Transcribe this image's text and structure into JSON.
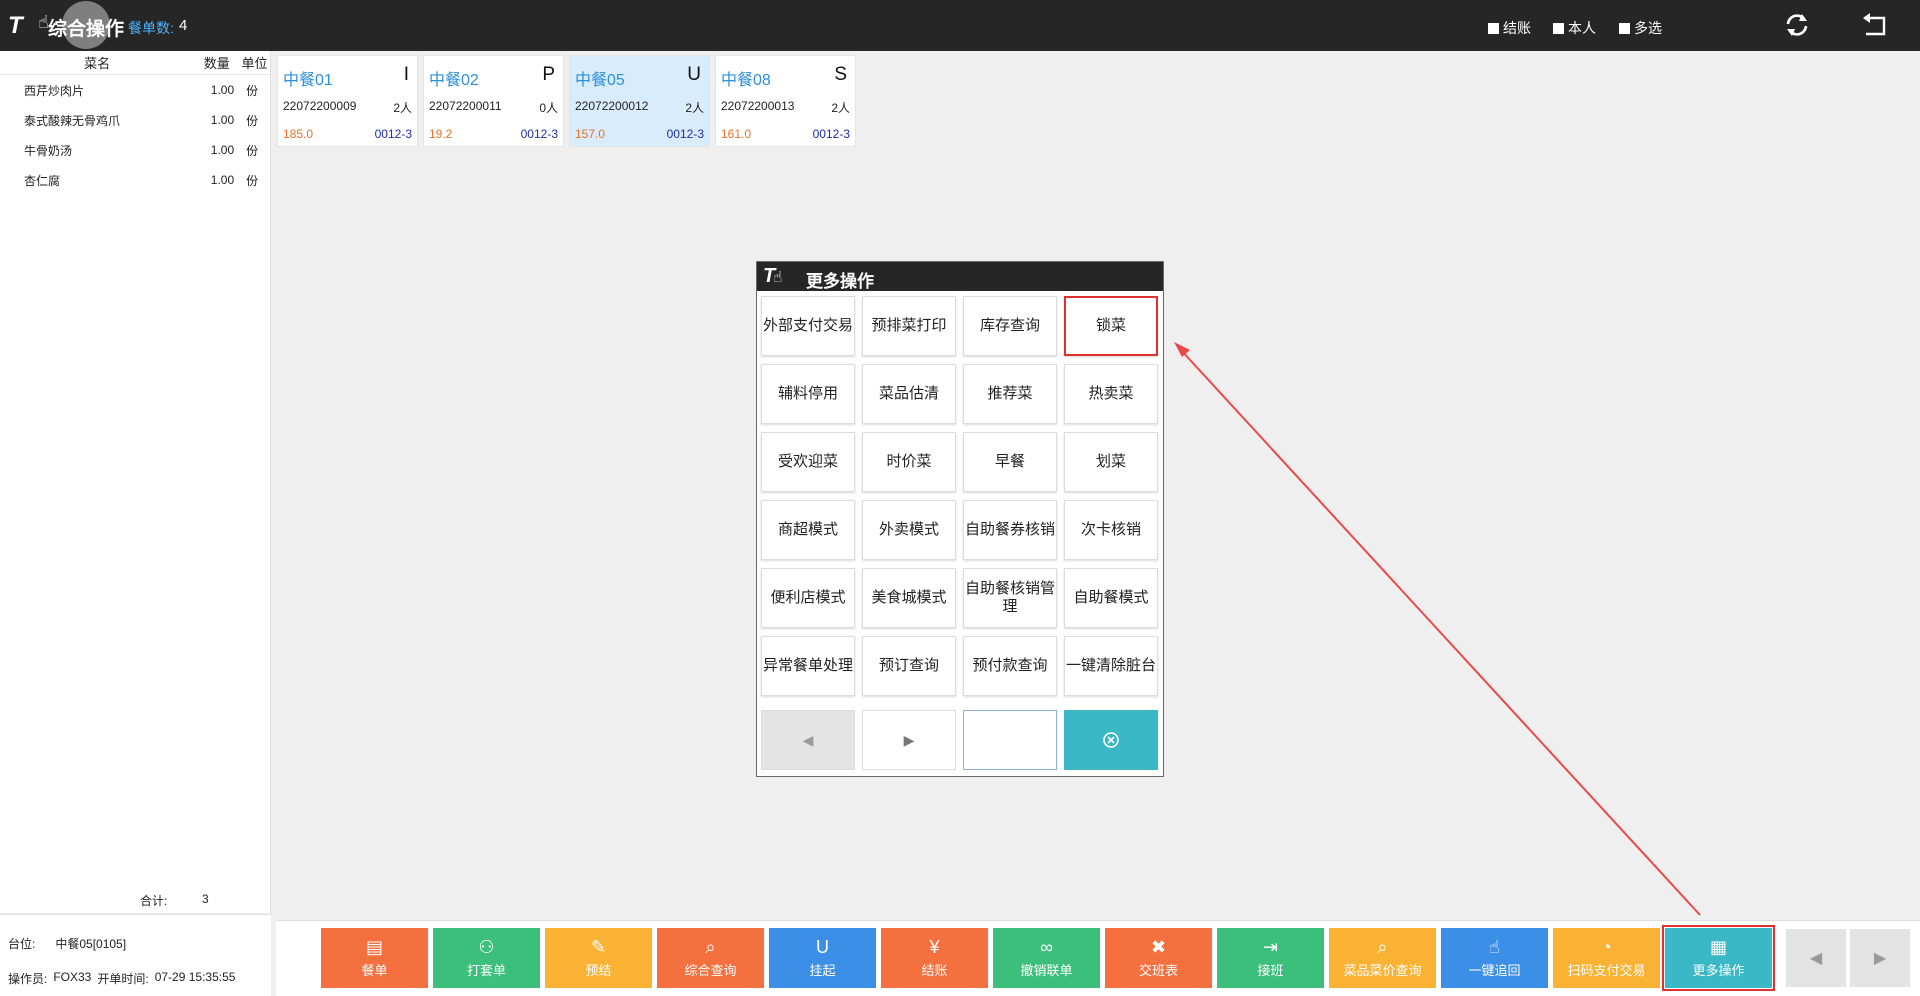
{
  "topbar": {
    "logo_text": "T",
    "title": "综合操作",
    "order_count_label": "餐单数:",
    "order_count": "4",
    "checkboxes": [
      "结账",
      "本人",
      "多选"
    ],
    "refresh_icon": "refresh-icon",
    "back_icon": "back-icon"
  },
  "item_list": {
    "headers": {
      "name": "菜名",
      "qty": "数量",
      "unit": "单位"
    },
    "rows": [
      {
        "name": "西芹炒肉片",
        "qty": "1.00",
        "unit": "份"
      },
      {
        "name": "泰式酸辣无骨鸡爪",
        "qty": "1.00",
        "unit": "份"
      },
      {
        "name": "牛骨奶汤",
        "qty": "1.00",
        "unit": "份"
      },
      {
        "name": "杏仁腐",
        "qty": "1.00",
        "unit": "份"
      }
    ],
    "total_label": "合计:",
    "total_value": "3"
  },
  "footer_info": {
    "table_label": "台位:",
    "table_value": "中餐05[0105]",
    "operator_label": "操作员:",
    "operator_value": "FOX33",
    "open_time_label": "开单时间:",
    "open_time_value": "07-29 15:35:55"
  },
  "orders": [
    {
      "name": "中餐01",
      "status": "I",
      "number": "22072200009",
      "people": "2人",
      "amount": "185.0",
      "code": "0012-3"
    },
    {
      "name": "中餐02",
      "status": "P",
      "number": "22072200011",
      "people": "0人",
      "amount": "19.2",
      "code": "0012-3"
    },
    {
      "name": "中餐05",
      "status": "U",
      "number": "22072200012",
      "people": "2人",
      "amount": "157.0",
      "code": "0012-3"
    },
    {
      "name": "中餐08",
      "status": "S",
      "number": "22072200013",
      "people": "2人",
      "amount": "161.0",
      "code": "0012-3"
    }
  ],
  "modal": {
    "title": "更多操作",
    "buttons": [
      "外部支付交易",
      "预排菜打印",
      "库存查询",
      "锁菜",
      "辅料停用",
      "菜品估清",
      "推荐菜",
      "热卖菜",
      "受欢迎菜",
      "时价菜",
      "早餐",
      "划菜",
      "商超模式",
      "外卖模式",
      "自助餐券核销",
      "次卡核销",
      "便利店模式",
      "美食城模式",
      "自助餐核销管理",
      "自助餐模式",
      "异常餐单处理",
      "预订查询",
      "预付款查询",
      "一键清除脏台"
    ],
    "input_value": "",
    "clear_icon": "clear-circle-icon"
  },
  "bottom_buttons": [
    {
      "label": "餐单",
      "icon": "▤",
      "color": "#f4703f"
    },
    {
      "label": "打套单",
      "icon": "⚇",
      "color": "#3cbf7a"
    },
    {
      "label": "预结",
      "icon": "✎",
      "color": "#f9b233"
    },
    {
      "label": "综合查询",
      "icon": "⌕",
      "color": "#f4703f"
    },
    {
      "label": "挂起",
      "icon": "U",
      "color": "#3b8fe6"
    },
    {
      "label": "结账",
      "icon": "¥",
      "color": "#f4703f"
    },
    {
      "label": "撤销联单",
      "icon": "∞",
      "color": "#3cbf7a"
    },
    {
      "label": "交班表",
      "icon": "✖",
      "color": "#f4703f"
    },
    {
      "label": "接班",
      "icon": "⇥",
      "color": "#3cbf7a"
    },
    {
      "label": "菜品菜价查询",
      "icon": "⌕",
      "color": "#f9b233"
    },
    {
      "label": "一键追回",
      "icon": "☝",
      "color": "#3b8fe6"
    },
    {
      "label": "扫码支付交易",
      "icon": "◔",
      "color": "#f9b233"
    },
    {
      "label": "更多操作",
      "icon": "▦",
      "color": "#3ab8c6"
    }
  ]
}
